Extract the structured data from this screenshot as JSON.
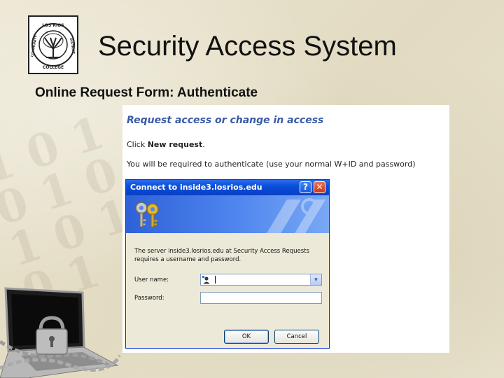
{
  "slide": {
    "title": "Security Access System",
    "subtitle": "Online Request Form: Authenticate"
  },
  "logo": {
    "top_text": "LOS RIOS",
    "left_text": "COMMUNITY",
    "right_text": "DISTRICT",
    "bottom_text": "COLLEGE"
  },
  "page_panel": {
    "heading": "Request access or change in access",
    "instruction_prefix": "Click",
    "instruction_bold": "New request",
    "instruction_suffix": ".",
    "auth_note": "You will be required to authenticate (use your normal W+ID and password)"
  },
  "dialog": {
    "title": "Connect to inside3.losrios.edu",
    "help_label": "?",
    "close_label": "✕",
    "message_line1": "The server inside3.losrios.edu at Security Access Requests",
    "message_line2": "requires a username and password.",
    "username_label": "User name:",
    "username_value": "",
    "password_label": "Password:",
    "password_value": "",
    "ok_label": "OK",
    "cancel_label": "Cancel",
    "dropdown_glyph": "▼"
  },
  "colors": {
    "heading_blue": "#3b5aa6",
    "titlebar_blue": "#0a4fd9",
    "dialog_face": "#ece9d8",
    "slide_background": "#e8e2cc"
  },
  "icons": {
    "logo": "college-seal-icon",
    "keys": "keys-icon",
    "user": "user-icon",
    "laptop": "locked-laptop-icon"
  }
}
